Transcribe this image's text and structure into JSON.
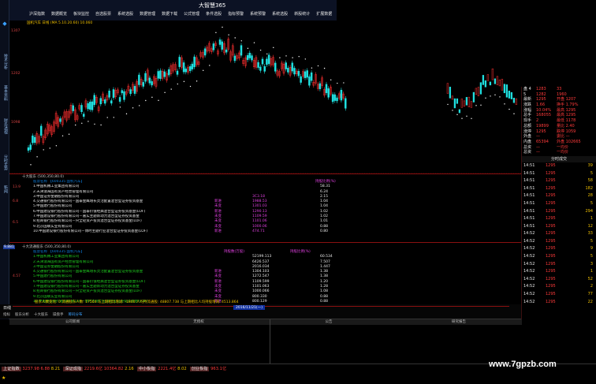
{
  "app_title": "大智慧365",
  "menu": [
    "沪深指数",
    "数据概览",
    "板块监控",
    "自选股票",
    "系统选股",
    "数据管理",
    "数据下载",
    "公式管理",
    "条件选股",
    "指标预警",
    "系统预警",
    "系统选股",
    "新股统计",
    "扩展数据"
  ],
  "left_tabs": [
    "技术分析",
    "基本资料",
    "财务透视",
    "分时走势",
    "新闻"
  ],
  "chart": {
    "info": "国机汽车 日线 (MA 5.10.20.60) 10.060",
    "price_labels": [
      "1307",
      "1202",
      "1098"
    ],
    "colors": {
      "up": "#ff3030",
      "down": "#20e0e0",
      "dots": "#ffffff",
      "divider": "#8a1010"
    }
  },
  "holders_top": {
    "title": "十大股东 (500,350,80.0)",
    "headers": [
      "股票名称 【600335 国机汽车】",
      "",
      "持股比例(%)"
    ],
    "left_labels": [
      "13.9",
      "6.8",
      "6.5"
    ],
    "rows": [
      {
        "name": "1.中国机械工业集团有限公司",
        "change": "",
        "ratio": "58.31"
      },
      {
        "name": "2.天津渤海国有资产经营管理有限公司",
        "change": "",
        "ratio": "6.24"
      },
      {
        "name": "3.中国证券金融股份有限公司",
        "change": "",
        "ratio": "2.15"
      },
      {
        "name": "4.交通银行股份有限公司－国泰金鹰增长灵活配置混合型证券投资基金",
        "change": "",
        "ratio": "1.04"
      },
      {
        "name": "5.中国建行股份有限公司",
        "change": "",
        "ratio": "1.04"
      },
      {
        "name": "6.中国建设银行股份有限公司－国泰价值经典混合型证券投资基金(LOF)",
        "change": "",
        "ratio": "1.02"
      },
      {
        "name": "7.中国建设银行股份有限公司－嘉实主题新动力混合型证券投资基金",
        "change": "",
        "ratio": "1.02"
      },
      {
        "name": "8.招商银行股份有限公司－兴全轻资产投资混合型证券投资基金(LOF)",
        "change": "",
        "ratio": "1.01"
      },
      {
        "name": "9.北京国联实业有限公司",
        "change": "",
        "ratio": "0.88"
      },
      {
        "name": "10.中国建设银行股份有限公司－博时主题行业混合型证券投资基金(LOF)",
        "change": "",
        "ratio": "0.80"
      }
    ],
    "changes": [
      "",
      "",
      "",
      "3C3.18",
      "1988.53",
      "1301.03",
      "1290.13",
      "1109.59",
      "1101.06",
      "1000.06",
      "474.71"
    ],
    "changes2": [
      "",
      "",
      "",
      "",
      "新进",
      "未变",
      "新进",
      "未变",
      "未变",
      "未变",
      "新进"
    ]
  },
  "holders_flow": {
    "title": "十大流通股东 (500,350,80.0)",
    "headers": [
      "股票名称 【600335 国机汽车】",
      "持股数(万股)",
      "持股比例(%)"
    ],
    "left_labels": [
      "9.881",
      "4.57"
    ],
    "ratios": [
      "60.534",
      "7.507",
      "1.447",
      "1.38",
      "1.38",
      "1.20",
      "1.28",
      "1.08",
      "0.88",
      "0.88"
    ],
    "amounts": [
      "52199.113",
      "6426.537",
      "2016.034",
      "1304.103",
      "1272.547",
      "1109.599",
      "1101.063",
      "1000.066",
      "800.330",
      "800.129"
    ]
  },
  "summary_line": "股东人数变化: 0   流通股东人数: 17564   与上期相比增减: -1800   人均持流通股: 48807.738   与上期相比人均持股增减: 4513.864",
  "date_bar": {
    "label": "日线",
    "date": "2016/11/21(一)"
  },
  "bottom_tabs": [
    "指标",
    "股东分析",
    "十大股东",
    "操盘手",
    "筹码分布"
  ],
  "lower_headers": [
    "公司新闻",
    "无授权",
    "公告",
    "研究报告"
  ],
  "right_panel": {
    "top_rows": [
      {
        "a": "盘 4",
        "b": "1283",
        "c": "33"
      },
      {
        "a": "5",
        "b": "1282",
        "c": "1960"
      },
      {
        "a": "最新",
        "b": "1295",
        "c": "开盘 1207"
      },
      {
        "a": "涨跌",
        "b": "1.66",
        "c": "换手 1.79%"
      },
      {
        "a": "涨幅",
        "b": "10.04%",
        "c": "最高 1295"
      },
      {
        "a": "总手",
        "b": "168055",
        "c": "最高 1295"
      },
      {
        "a": "现手",
        "b": "2",
        "c": "最低 1178"
      },
      {
        "a": "总额",
        "b": "19899",
        "c": "量比 2.40"
      },
      {
        "a": "涨停",
        "b": "1295",
        "c": "跌停 1059"
      },
      {
        "a": "外盘",
        "b": "—",
        "c": "委比 —"
      },
      {
        "a": "内盘",
        "b": "65394",
        "c": "外盘 102665"
      },
      {
        "a": "总资",
        "b": "—",
        "c": "一均价"
      },
      {
        "a": "总资",
        "b": "—",
        "c": "一均价"
      }
    ],
    "tick_title": "分时成交",
    "ticks": [
      {
        "t": "14:51",
        "p": "1295",
        "v": "39"
      },
      {
        "t": "14:51",
        "p": "1295",
        "v": "5"
      },
      {
        "t": "14:51",
        "p": "1295",
        "v": "58"
      },
      {
        "t": "14:51",
        "p": "1295",
        "v": "182"
      },
      {
        "t": "14:51",
        "p": "1295",
        "v": "28"
      },
      {
        "t": "14:51",
        "p": "1295",
        "v": "5"
      },
      {
        "t": "14:51",
        "p": "1295",
        "v": "294"
      },
      {
        "t": "14:51",
        "p": "1295",
        "v": "1"
      },
      {
        "t": "14:51",
        "p": "1295",
        "v": "12"
      },
      {
        "t": "14:52",
        "p": "1295",
        "v": "33"
      },
      {
        "t": "14:52",
        "p": "1295",
        "v": "5"
      },
      {
        "t": "14:52",
        "p": "1295",
        "v": "9"
      },
      {
        "t": "14:52",
        "p": "1295",
        "v": "5"
      },
      {
        "t": "14:52",
        "p": "1295",
        "v": "3"
      },
      {
        "t": "14:52",
        "p": "1295",
        "v": "1"
      },
      {
        "t": "14:52",
        "p": "1295",
        "v": "52"
      },
      {
        "t": "14:52",
        "p": "1295",
        "v": "2"
      },
      {
        "t": "14:52",
        "p": "1295",
        "v": "77"
      },
      {
        "t": "14:52",
        "p": "1295",
        "v": "22"
      }
    ]
  },
  "status_bar": [
    {
      "label": "上证指数",
      "val": "3237.98",
      "chg": "6.88",
      "amt": "8.21"
    },
    {
      "label": "深证成指",
      "val": "2219.6亿",
      "chg": "10364.82",
      "amt": "2.16"
    },
    {
      "label": "中小板指",
      "val": "2221.4亿",
      "chg": "",
      "amt": "8.02"
    },
    {
      "label": "创业板指",
      "val": "963.1亿",
      "chg": "",
      "amt": ""
    }
  ],
  "watermark": "www.7gpzb.com"
}
